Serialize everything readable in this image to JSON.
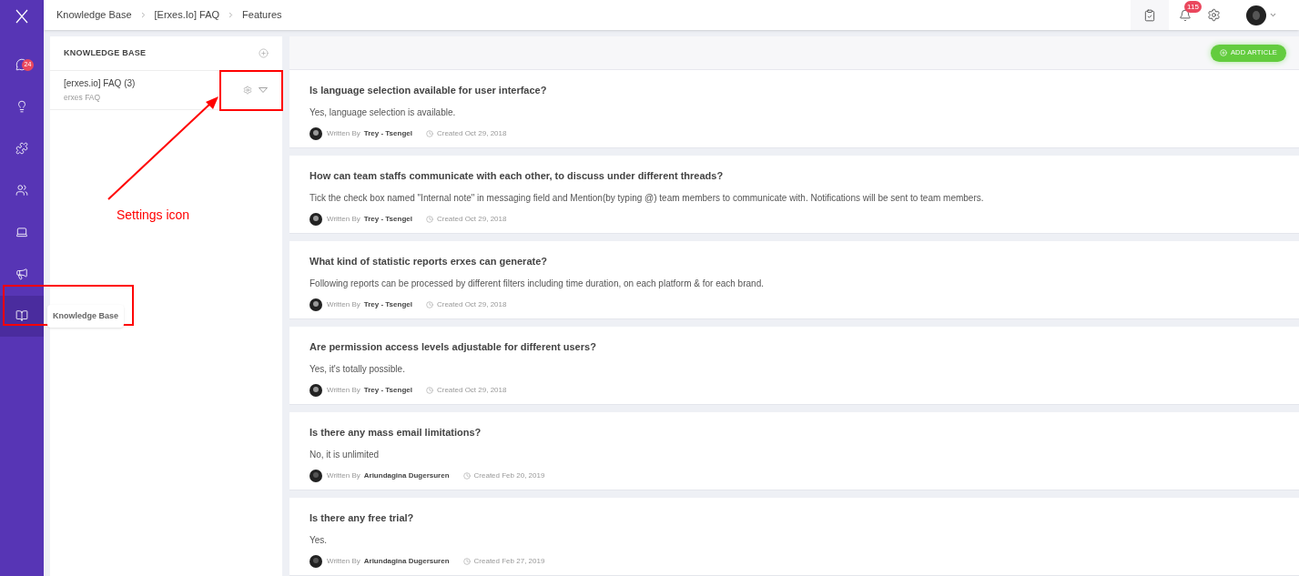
{
  "breadcrumbs": [
    "Knowledge Base",
    "[Erxes.Io] FAQ",
    "Features"
  ],
  "sidebar": {
    "items": [
      {
        "kind": "chat",
        "selected": false,
        "badge": "24"
      },
      {
        "kind": "bulb",
        "selected": false
      },
      {
        "kind": "puzzle",
        "selected": false
      },
      {
        "kind": "people",
        "selected": false
      },
      {
        "kind": "laptop",
        "selected": false
      },
      {
        "kind": "megaphone",
        "selected": false
      },
      {
        "kind": "book",
        "selected": true,
        "tooltip": "Knowledge Base"
      }
    ]
  },
  "header": {
    "notifications_badge": "115"
  },
  "knowledge_base": {
    "title": "KNOWLEDGE BASE",
    "topics": [
      {
        "title": "[erxes.io] FAQ (3)",
        "description": "erxes FAQ"
      }
    ]
  },
  "add_article": "ADD ARTICLE",
  "articles": [
    {
      "title": "Is language selection available for user interface?",
      "summary": "Yes, language selection is available.",
      "written_by": "Written By",
      "author": "Trey - Tsengel",
      "created": "Created Oct 29, 2018"
    },
    {
      "title": "How can team staffs communicate with each other, to discuss under different threads?",
      "summary": "Tick the check box named \"Internal note\" in messaging field and Mention(by typing @) team members to communicate with. Notifications will be sent to team members.",
      "written_by": "Written By",
      "author": "Trey - Tsengel",
      "created": "Created Oct 29, 2018"
    },
    {
      "title": "What kind of statistic reports erxes can generate?",
      "summary": "Following reports can be processed by different filters including time duration, on each platform & for each brand.",
      "written_by": "Written By",
      "author": "Trey - Tsengel",
      "created": "Created Oct 29, 2018"
    },
    {
      "title": "Are permission access levels adjustable for different users?",
      "summary": "Yes, it's totally possible.",
      "written_by": "Written By",
      "author": "Trey - Tsengel",
      "created": "Created Oct 29, 2018"
    },
    {
      "title": "Is there any mass email limitations?",
      "summary": "No, it is unlimited",
      "written_by": "Written By",
      "author": "Ariundagina Dugersuren",
      "created": "Created Feb 20, 2019"
    },
    {
      "title": "Is there any free trial?",
      "summary": "Yes.",
      "written_by": "Written By",
      "author": "Ariundagina Dugersuren",
      "created": "Created Feb 27, 2019"
    }
  ],
  "annotation": {
    "label": "Settings icon"
  }
}
